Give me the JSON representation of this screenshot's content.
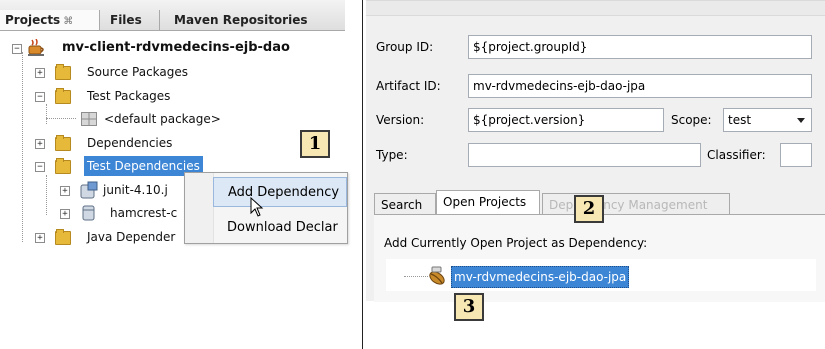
{
  "left": {
    "tabs": {
      "projects": "Projects",
      "projects_close": "⌘",
      "files": "Files",
      "maven": "Maven Repositories"
    },
    "tree": {
      "root": "mv-client-rdvmedecins-ejb-dao",
      "source_packages": "Source Packages",
      "test_packages": "Test Packages",
      "default_package": "<default package>",
      "dependencies": "Dependencies",
      "test_dependencies": "Test Dependencies",
      "junit": "junit-4.10.j",
      "hamcrest": "hamcrest-c",
      "java_dependencies": "Java Depender"
    },
    "context_menu": {
      "add_dependency": "Add Dependency",
      "download_declared": "Download Declar"
    }
  },
  "callouts": {
    "one": "1",
    "two": "2",
    "three": "3"
  },
  "form": {
    "group_id_label": "Group ID:",
    "group_id_value": "${project.groupId}",
    "artifact_id_label": "Artifact ID:",
    "artifact_id_value": "mv-rdvmedecins-ejb-dao-jpa",
    "version_label": "Version:",
    "version_value": "${project.version}",
    "scope_label": "Scope:",
    "scope_value": "test",
    "type_label": "Type:",
    "type_value": "",
    "classifier_label": "Classifier:",
    "classifier_value": ""
  },
  "dialog_tabs": {
    "search": "Search",
    "open_projects": "Open Projects",
    "dependency_management": "Dependency Management"
  },
  "open_projects": {
    "heading": "Add Currently Open Project as Dependency:",
    "items": [
      "mv-rdvmedecins-ejb-dao-jpa"
    ]
  },
  "colors": {
    "selection": "#3d86d6",
    "callout_fill": "#f7e7b3",
    "folder": "#e7b93a"
  },
  "icons": {
    "project": "coffee-cup-project-icon",
    "folder": "package-folder-icon",
    "jar": "jar-library-icon",
    "cursor": "mouse-pointer-icon"
  }
}
